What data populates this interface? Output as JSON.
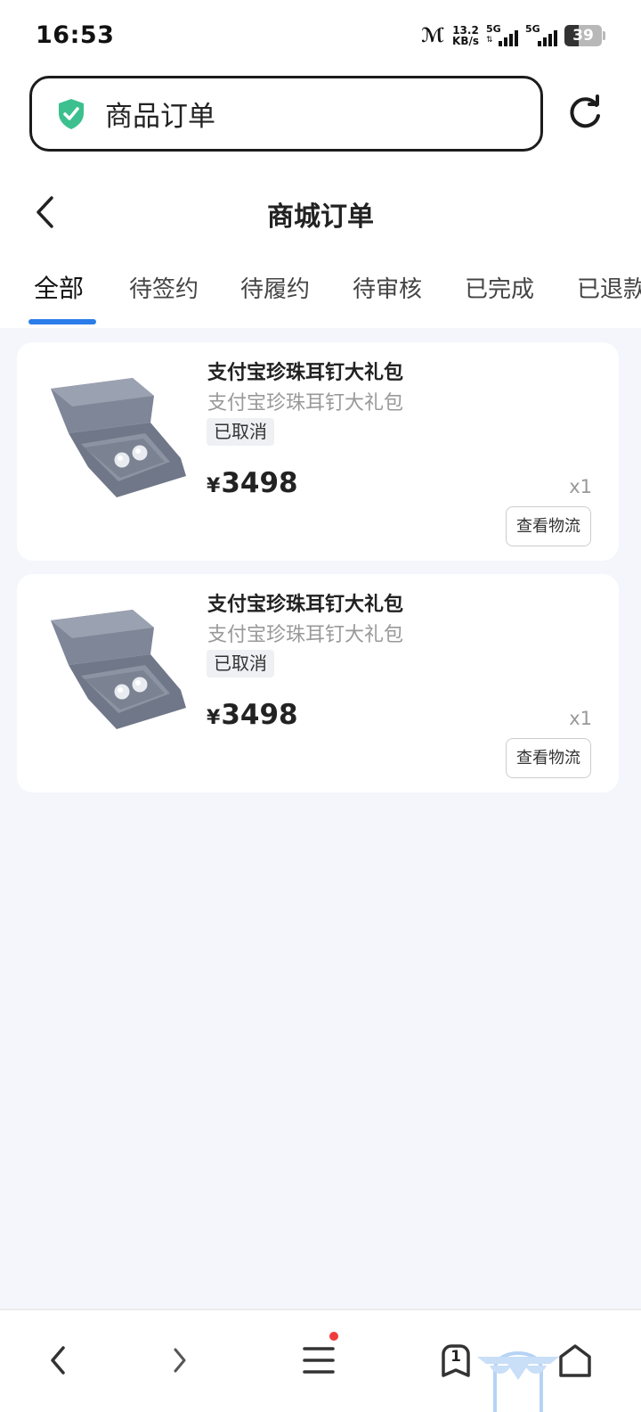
{
  "status_bar": {
    "time": "16:53",
    "nfc": "ℳ",
    "net_speed_value": "13.2",
    "net_speed_unit": "KB/s",
    "sim1_network": "5G",
    "sim2_network": "5G",
    "battery_level": "39",
    "battery_fraction": 0.39
  },
  "browser": {
    "url_text": "商品订单",
    "secure_icon": "shield-check-icon",
    "reload_icon": "reload-icon"
  },
  "page": {
    "title": "商城订单",
    "back_icon": "chevron-left-icon"
  },
  "tabs": [
    {
      "label": "全部",
      "active": true
    },
    {
      "label": "待签约"
    },
    {
      "label": "待履约"
    },
    {
      "label": "待审核"
    },
    {
      "label": "已完成"
    },
    {
      "label": "已退款"
    }
  ],
  "orders": [
    {
      "name": "支付宝珍珠耳钉大礼包",
      "subtitle": "支付宝珍珠耳钉大礼包",
      "status": "已取消",
      "currency": "¥",
      "price": "3498",
      "quantity": "x1",
      "action_label": "查看物流"
    },
    {
      "name": "支付宝珍珠耳钉大礼包",
      "subtitle": "支付宝珍珠耳钉大礼包",
      "status": "已取消",
      "currency": "¥",
      "price": "3498",
      "quantity": "x1",
      "action_label": "查看物流"
    }
  ],
  "bottom_nav": {
    "items": [
      "back-arrow-icon",
      "forward-arrow-icon",
      "menu-icon",
      "tabs-icon",
      "home-icon"
    ],
    "open_tabs_count": "1",
    "accent_color": "#2b7de9",
    "notification_color": "#f03c3c"
  }
}
